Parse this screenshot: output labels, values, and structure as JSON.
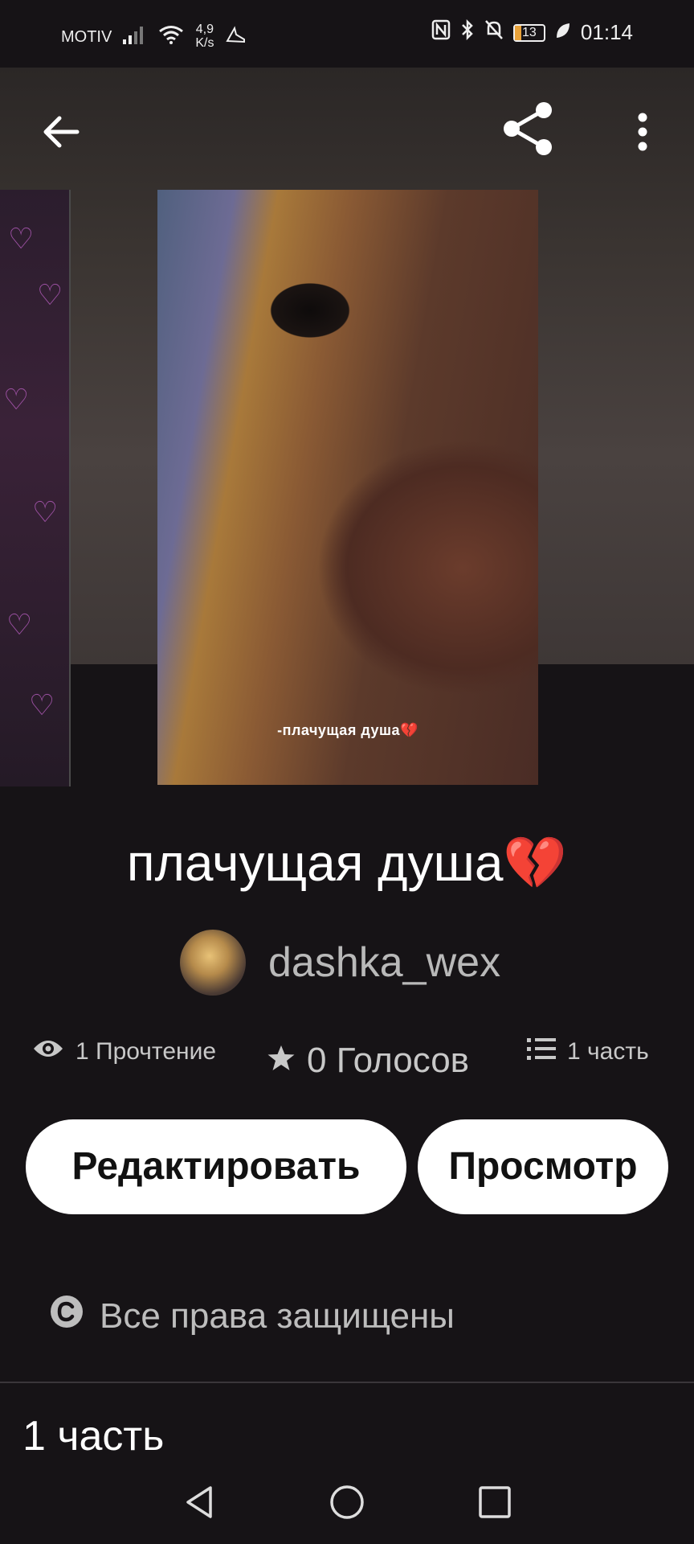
{
  "status_bar": {
    "carrier": "MOTIV",
    "speed_value": "4,9",
    "speed_unit": "K/s",
    "battery": "13",
    "time": "01:14"
  },
  "cover": {
    "caption": "-плачущая душа💔"
  },
  "story": {
    "title": "плачущая душа💔",
    "author": "dashka_wex",
    "stats": {
      "reads": "1 Прочтение",
      "votes": "0 Голосов",
      "parts": "1 часть"
    },
    "edit_label": "Редактировать",
    "view_label": "Просмотр",
    "rights": "Все права защищены",
    "section_title": "1 часть"
  },
  "icons": [
    "back-arrow-icon",
    "share-icon",
    "more-vert-icon",
    "eye-icon",
    "star-icon",
    "list-icon",
    "copyright-icon",
    "nav-back-icon",
    "nav-home-icon",
    "nav-recents-icon"
  ]
}
